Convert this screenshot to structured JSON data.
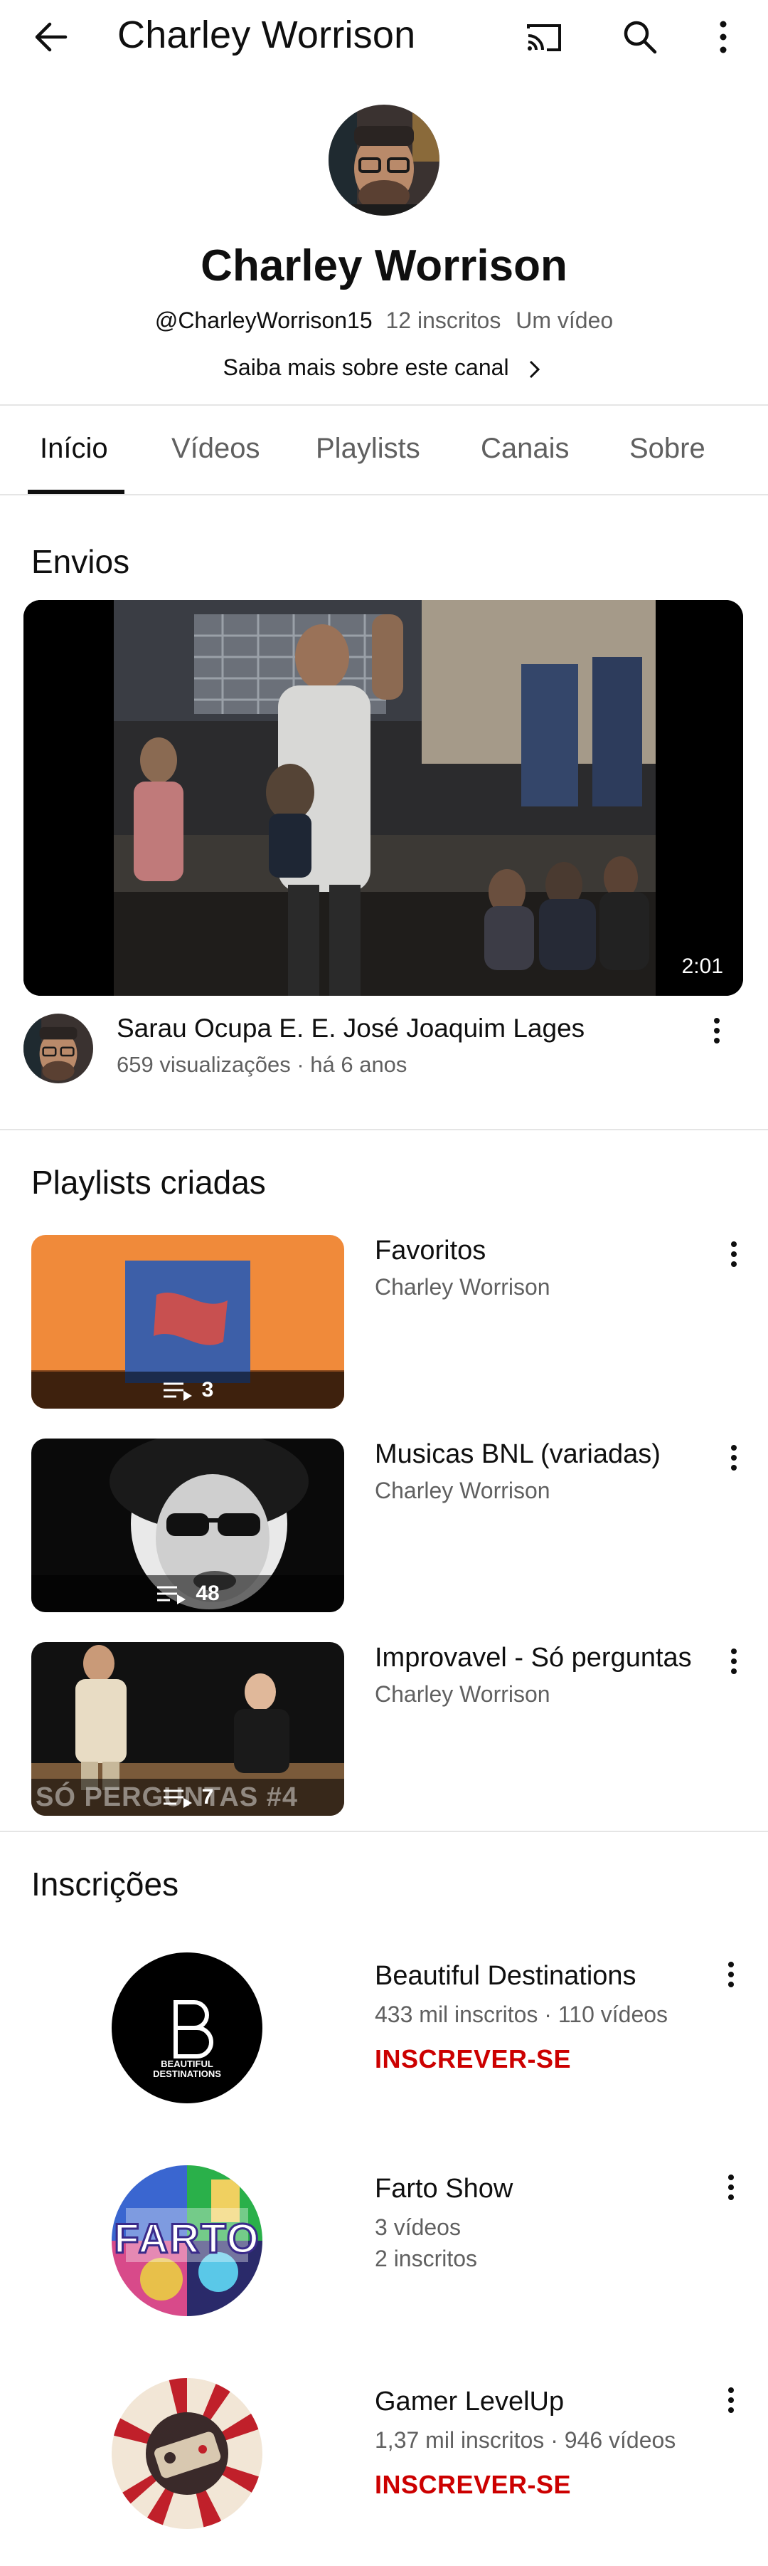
{
  "topbar": {
    "title": "Charley Worrison",
    "icons": [
      "back-arrow-icon",
      "cast-icon",
      "search-icon",
      "more-vert-icon"
    ]
  },
  "channel": {
    "name": "Charley Worrison",
    "handle": "@CharleyWorrison15",
    "subscribers": "12 inscritos",
    "videos": "Um vídeo",
    "about_link": "Saiba mais sobre este canal"
  },
  "tabs": [
    "Início",
    "Vídeos",
    "Playlists",
    "Canais",
    "Sobre"
  ],
  "uploads": {
    "title": "Envios",
    "video": {
      "title": "Sarau Ocupa E. E. José Joaquim Lages",
      "meta": "659 visualizações · há 6 anos",
      "duration": "2:01"
    }
  },
  "playlists": {
    "title": "Playlists criadas",
    "items": [
      {
        "title": "Favoritos",
        "owner": "Charley Worrison",
        "count": "3"
      },
      {
        "title": "Musicas BNL (variadas)",
        "owner": "Charley Worrison",
        "count": "48"
      },
      {
        "title": "Improvavel - Só perguntas",
        "owner": "Charley Worrison",
        "count": "7",
        "thumb_text": "SÓ PERGUNTAS #4"
      }
    ]
  },
  "subscriptions": {
    "title": "Inscrições",
    "items": [
      {
        "name": "Beautiful Destinations",
        "meta": "433 mil inscritos · 110 vídeos",
        "button": "INSCREVER-SE",
        "logo_text": "BEAUTIFUL DESTINATIONS"
      },
      {
        "name": "Farto Show",
        "meta": "3 vídeos",
        "meta2": "2 inscritos",
        "logo_text": "FARTO"
      },
      {
        "name": "Gamer LevelUp",
        "meta": "1,37 mil inscritos · 946 vídeos",
        "button": "INSCREVER-SE"
      }
    ]
  },
  "colors": {
    "subscribe": "#cc0000",
    "secondary_text": "#606060",
    "divider": "#e5e5e5"
  }
}
